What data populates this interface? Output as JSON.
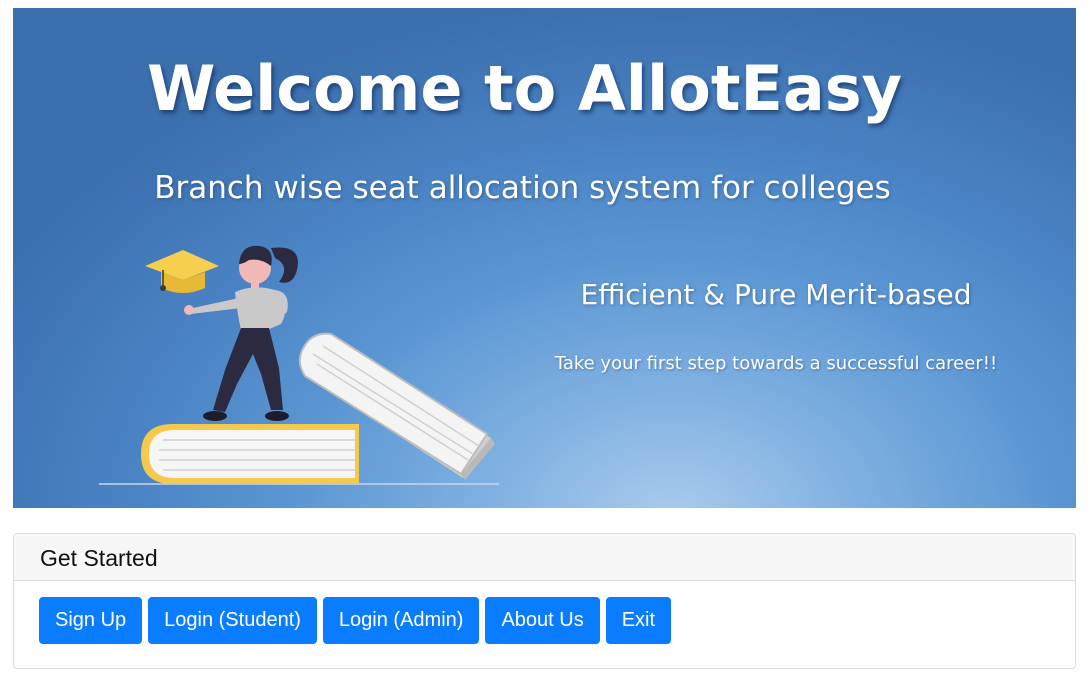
{
  "banner": {
    "title": "Welcome to AllotEasy",
    "subtitle": "Branch wise seat allocation system for colleges",
    "tagline": "Efficient & Pure Merit-based",
    "cta": "Take your first step towards a successful career!!",
    "illustration_icons": [
      "graduation-cap-icon",
      "student-figure",
      "book-stack"
    ]
  },
  "card": {
    "header": "Get Started",
    "buttons": [
      {
        "label": "Sign Up"
      },
      {
        "label": "Login (Student)"
      },
      {
        "label": "Login (Admin)"
      },
      {
        "label": "About Us"
      },
      {
        "label": "Exit"
      }
    ]
  },
  "colors": {
    "banner_blue": "#4a83c4",
    "button_blue": "#0a7cff",
    "book_yellow": "#f5c94e",
    "cap_yellow": "#f7cf4f",
    "pants_navy": "#2c2a40"
  }
}
